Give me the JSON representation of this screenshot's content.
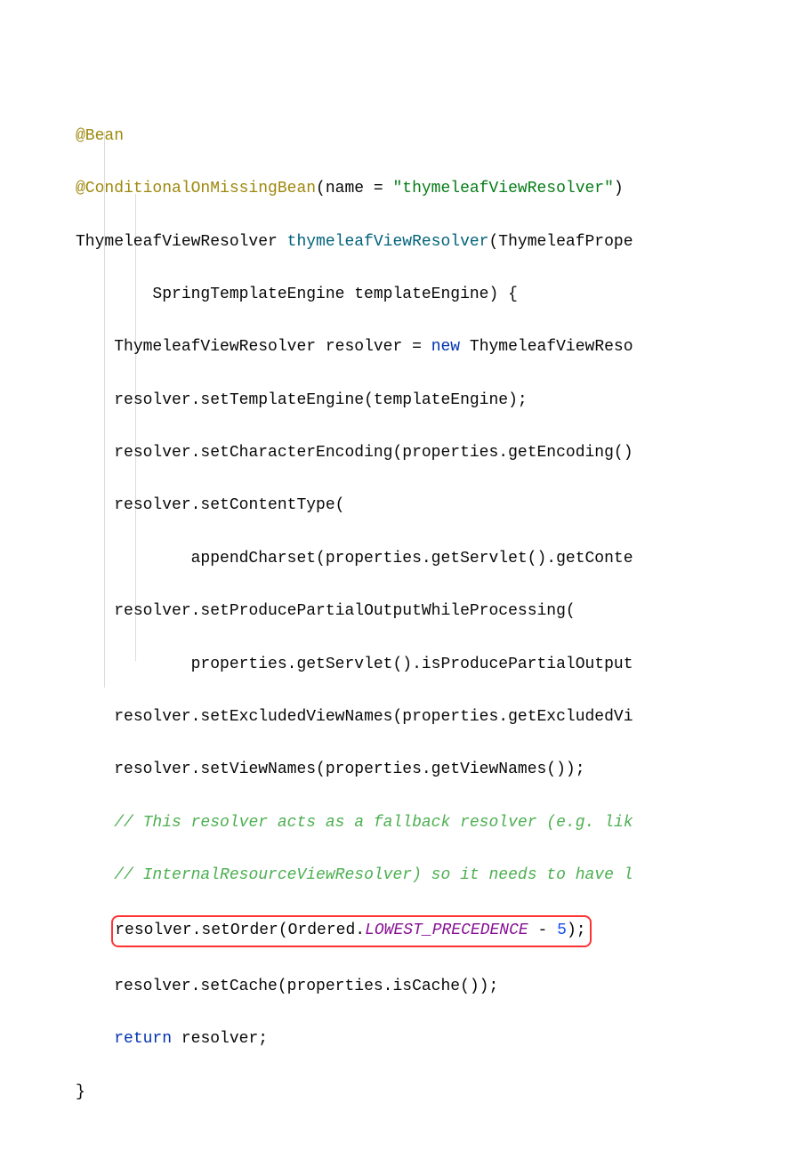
{
  "code": {
    "l1_annotation": "@Bean",
    "l2_annotation": "@ConditionalOnMissingBean",
    "l2_punct1": "(name = ",
    "l2_string": "\"thymeleafViewResolver\"",
    "l2_punct2": ")",
    "l3_type": "ThymeleafViewResolver ",
    "l3_method": "thymeleafViewResolver",
    "l3_rest": "(ThymeleafPrope",
    "l4": "SpringTemplateEngine templateEngine) {",
    "l5a": "ThymeleafViewResolver resolver = ",
    "l5_new": "new ",
    "l5b": "ThymeleafViewReso",
    "l6": "resolver.setTemplateEngine(templateEngine);",
    "l7": "resolver.setCharacterEncoding(properties.getEncoding()",
    "l8": "resolver.setContentType(",
    "l9": "appendCharset(properties.getServlet().getConte",
    "l10": "resolver.setProducePartialOutputWhileProcessing(",
    "l11": "properties.getServlet().isProducePartialOutput",
    "l12": "resolver.setExcludedViewNames(properties.getExcludedVi",
    "l13": "resolver.setViewNames(properties.getViewNames());",
    "l14": "// This resolver acts as a fallback resolver (e.g. lik",
    "l15": "// InternalResourceViewResolver) so it needs to have l",
    "l16a": "resolver.setOrder(Ordered.",
    "l16_const": "LOWEST_PRECEDENCE",
    "l16b": " - ",
    "l16_num": "5",
    "l16c": ");",
    "l17": "resolver.setCache(properties.isCache());",
    "l18_ret": "return ",
    "l18_rest": "resolver;",
    "l19": "}"
  }
}
